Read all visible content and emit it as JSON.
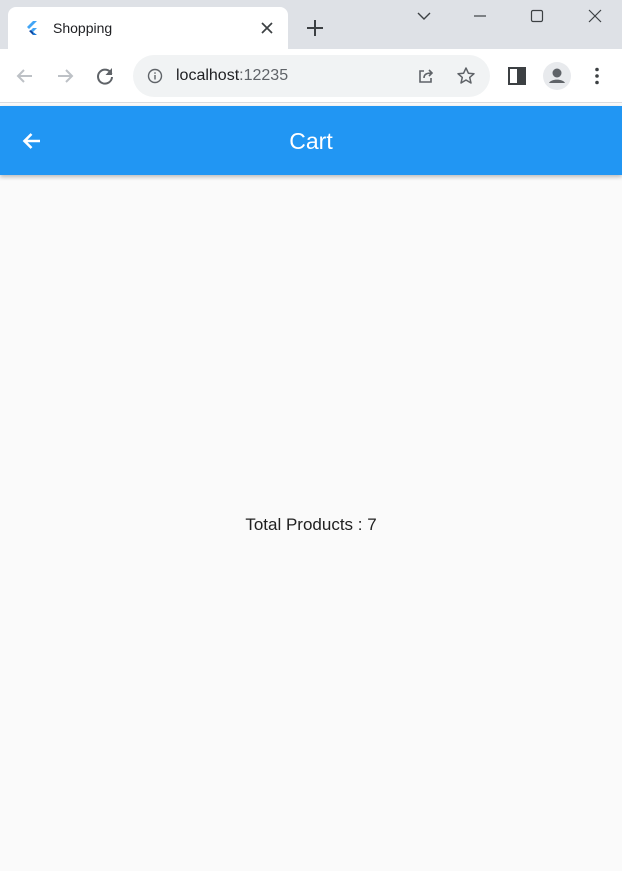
{
  "browser": {
    "tab": {
      "title": "Shopping",
      "favicon_icon": "flutter-logo-icon",
      "close_icon": "close-icon"
    },
    "new_tab_icon": "plus-icon",
    "window_controls": [
      "chevron-down-icon",
      "minimize-icon",
      "maximize-icon",
      "close-icon"
    ],
    "toolbar": {
      "back_icon": "arrow-left-icon",
      "forward_icon": "arrow-right-icon",
      "reload_icon": "reload-icon",
      "site_info_icon": "info-icon",
      "url_host": "localhost",
      "url_port": ":12235",
      "share_icon": "share-icon",
      "bookmark_icon": "star-icon",
      "side_panel_icon": "side-panel-icon",
      "profile_icon": "person-icon",
      "menu_icon": "kebab-menu-icon"
    }
  },
  "app": {
    "appbar": {
      "title": "Cart",
      "back_icon": "arrow-back-icon",
      "color": "#2196f3"
    },
    "body": {
      "total_products": "Total Products : 7"
    }
  }
}
